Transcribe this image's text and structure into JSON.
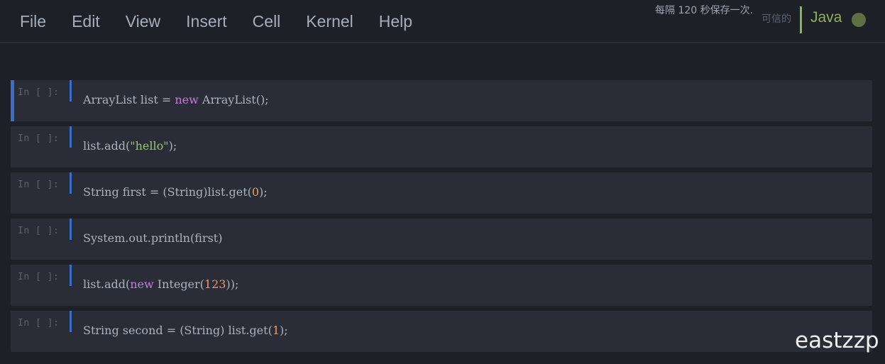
{
  "menu": {
    "items": [
      "File",
      "Edit",
      "View",
      "Insert",
      "Cell",
      "Kernel",
      "Help"
    ]
  },
  "status": {
    "autosave": "每隔 120 秒保存一次.",
    "trusted": "可信的",
    "kernel": "Java"
  },
  "cells": [
    {
      "prompt": "In  [  ]:",
      "tokens": [
        {
          "t": "ArrayList list = ",
          "c": ""
        },
        {
          "t": "new",
          "c": "kw"
        },
        {
          "t": " ArrayList();",
          "c": ""
        }
      ]
    },
    {
      "prompt": "In  [  ]:",
      "tokens": [
        {
          "t": "list.add(",
          "c": ""
        },
        {
          "t": "\"hello\"",
          "c": "str"
        },
        {
          "t": ");",
          "c": ""
        }
      ]
    },
    {
      "prompt": "In  [  ]:",
      "tokens": [
        {
          "t": "String first = (String)list.get(",
          "c": ""
        },
        {
          "t": "0",
          "c": "num"
        },
        {
          "t": ");",
          "c": ""
        }
      ]
    },
    {
      "prompt": "In  [  ]:",
      "tokens": [
        {
          "t": "System.out.println(first)",
          "c": ""
        }
      ]
    },
    {
      "prompt": "In  [  ]:",
      "tokens": [
        {
          "t": "list.add(",
          "c": ""
        },
        {
          "t": "new",
          "c": "kw"
        },
        {
          "t": " Integer(",
          "c": ""
        },
        {
          "t": "123",
          "c": "num"
        },
        {
          "t": "));",
          "c": ""
        }
      ]
    },
    {
      "prompt": "In  [  ]:",
      "tokens": [
        {
          "t": "String second = (String) list.get(",
          "c": ""
        },
        {
          "t": "1",
          "c": "num"
        },
        {
          "t": ");",
          "c": ""
        }
      ]
    }
  ],
  "watermark": "eastzzp"
}
